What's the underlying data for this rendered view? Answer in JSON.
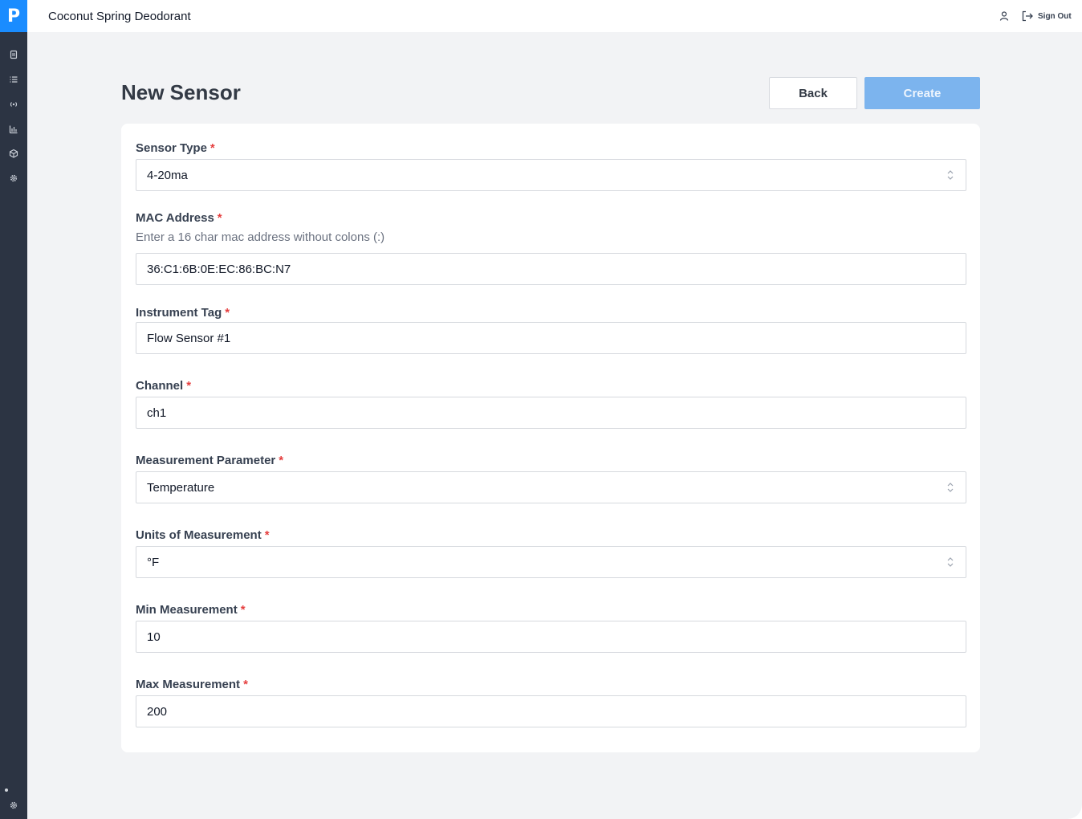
{
  "app": {
    "logo": "P",
    "title": "Coconut Spring Deodorant"
  },
  "header": {
    "signout_label": "Sign Out"
  },
  "sidebar": {
    "icons": [
      "document-icon",
      "list-icon",
      "broadcast-icon",
      "bar-chart-icon",
      "cube-icon",
      "gear-icon",
      "settings-icon"
    ]
  },
  "page": {
    "title": "New Sensor",
    "back_label": "Back",
    "create_label": "Create"
  },
  "form": {
    "sensor_type": {
      "label": "Sensor Type",
      "value": "4-20ma"
    },
    "mac_address": {
      "label": "MAC Address",
      "hint": "Enter a 16 char mac address without colons (:)",
      "value": "36:C1:6B:0E:EC:86:BC:N7"
    },
    "instrument_tag": {
      "label": "Instrument Tag",
      "value": "Flow Sensor #1"
    },
    "channel": {
      "label": "Channel",
      "value": "ch1"
    },
    "measurement_parameter": {
      "label": "Measurement Parameter",
      "value": "Temperature"
    },
    "units": {
      "label": "Units of Measurement",
      "value": "°F"
    },
    "min_measurement": {
      "label": "Min Measurement",
      "value": "10"
    },
    "max_measurement": {
      "label": "Max Measurement",
      "value": "200"
    },
    "required_mark": "*"
  },
  "colors": {
    "brand": "#1a8cff",
    "sidebar": "#2c3443",
    "create_button": "#7cb4ee",
    "required": "#e53e3e"
  }
}
